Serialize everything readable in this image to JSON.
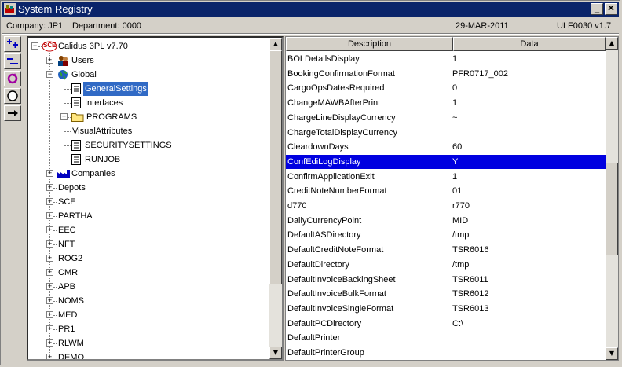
{
  "window": {
    "title": "System Registry"
  },
  "info": {
    "company": "Company:  JP1",
    "department": "Department:  0000",
    "date": "29-MAR-2011",
    "version": "ULF0030  v1.7"
  },
  "tree": {
    "root": "Calidus 3PL v7.70",
    "root_badge": "SCE",
    "users": "Users",
    "global": "Global",
    "general_settings": "GeneralSettings",
    "interfaces": "Interfaces",
    "programs": "PROGRAMS",
    "visual_attributes": "VisualAttributes",
    "security_settings": "SECURITYSETTINGS",
    "runjob": "RUNJOB",
    "companies": "Companies",
    "others": [
      "Depots",
      "SCE",
      "PARTHA",
      "EEC",
      "NFT",
      "ROG2",
      "CMR",
      "APB",
      "NOMS",
      "MED",
      "PR1",
      "RLWM",
      "DEMO"
    ]
  },
  "grid": {
    "headers": {
      "description": "Description",
      "data": "Data"
    },
    "rows": [
      [
        "BOLDetailsDisplay",
        "1"
      ],
      [
        "BookingConfirmationFormat",
        "PFR0717_002"
      ],
      [
        "CargoOpsDatesRequired",
        "0"
      ],
      [
        "ChangeMAWBAfterPrint",
        "1"
      ],
      [
        "ChargeLineDisplayCurrency",
        "~"
      ],
      [
        "ChargeTotalDisplayCurrency",
        ""
      ],
      [
        "CleardownDays",
        "60"
      ],
      [
        "ConfEdiLogDisplay",
        "Y"
      ],
      [
        "ConfirmApplicationExit",
        "1"
      ],
      [
        "CreditNoteNumberFormat",
        "01"
      ],
      [
        "d770",
        "r770"
      ],
      [
        "DailyCurrencyPoint",
        "MID"
      ],
      [
        "DefaultASDirectory",
        "/tmp"
      ],
      [
        "DefaultCreditNoteFormat",
        "TSR6016"
      ],
      [
        "DefaultDirectory",
        "/tmp"
      ],
      [
        "DefaultInvoiceBackingSheet",
        "TSR6011"
      ],
      [
        "DefaultInvoiceBulkFormat",
        "TSR6012"
      ],
      [
        "DefaultInvoiceSingleFormat",
        "TSR6013"
      ],
      [
        "DefaultPCDirectory",
        "C:\\"
      ],
      [
        "DefaultPrinter",
        ""
      ],
      [
        "DefaultPrinterGroup",
        ""
      ]
    ],
    "selected_index": 7
  },
  "colors": {
    "title_bar": "#0a246a",
    "selection": "#0000e0",
    "tree_selection": "#316ac5"
  }
}
